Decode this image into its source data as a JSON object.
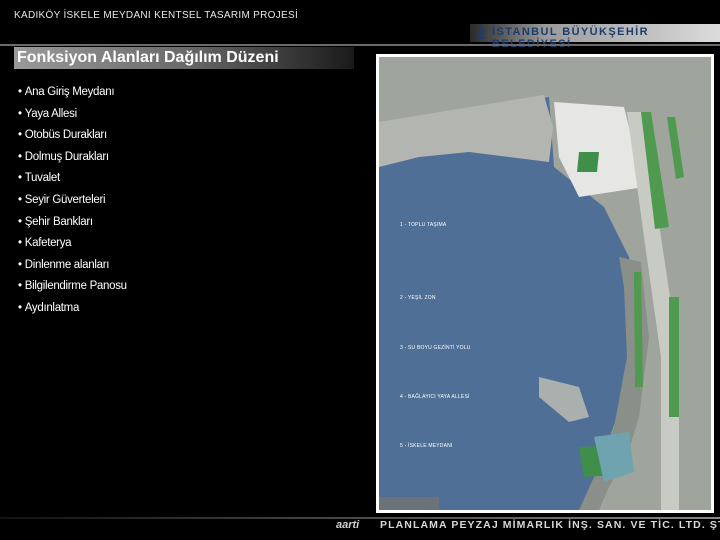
{
  "header": {
    "project_title": "KADIKÖY İSKELE MEYDANI KENTSEL TASARIM PROJESİ",
    "municipality_logo_text": "İSTANBUL BÜYÜKŞEHİR BELEDİYESİ"
  },
  "slide": {
    "title": "Fonksiyon Alanları Dağılım Düzeni",
    "bullet_glyph": "•",
    "bullets": [
      "Ana Giriş Meydanı",
      "Yaya Allesi",
      "Otobüs Durakları",
      "Dolmuş Durakları",
      "Tuvalet",
      "Seyir Güverteleri",
      "Şehir Bankları",
      "Kafeterya",
      "Dinlenme alanları",
      "Bilgilendirme Panosu",
      "Aydınlatma"
    ]
  },
  "site_plan": {
    "zone_labels": [
      "1   - TOPLU TAŞIMA",
      "2   - YEŞİL ZON",
      "3   - SU BOYU GEZİNTİ YOLU",
      "4   - BAĞLAYICI YAYA ALLESİ",
      "5   - İSKELE MEYDANI"
    ],
    "colors": {
      "sea": "#4f6f96",
      "land": "#b8bcb4",
      "green": "#4f9a4f",
      "plaza": "#8a8f8a"
    }
  },
  "footer": {
    "company_logo": "aarti",
    "company_name": "PLANLAMA PEYZAJ MİMARLIK İNŞ. SAN. VE TİC. LTD. ŞTİ."
  }
}
